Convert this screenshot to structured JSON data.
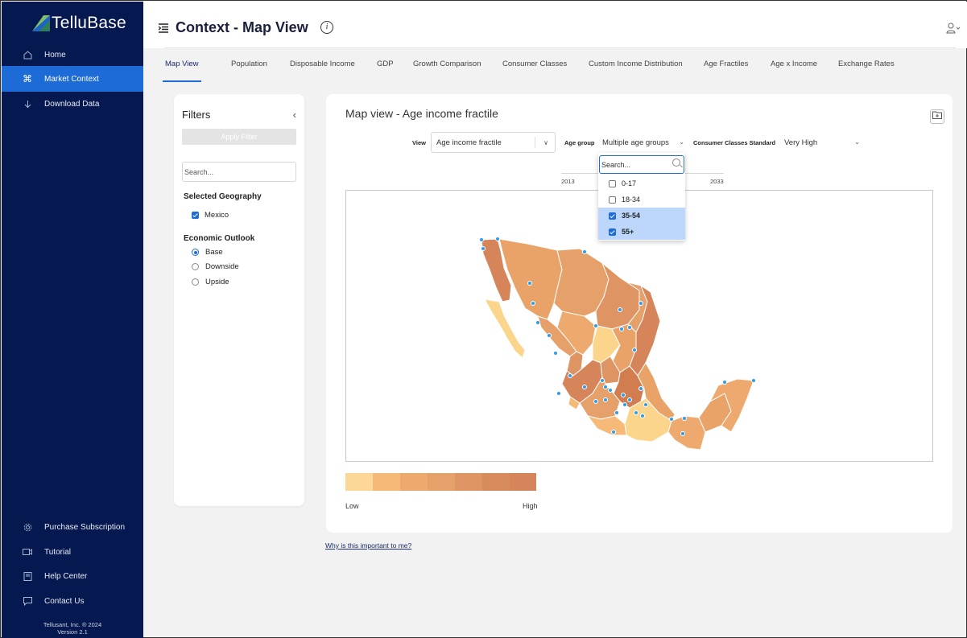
{
  "app": {
    "name": "TelluBase",
    "copyright_line1": "Tellusant, Inc. ® 2024",
    "copyright_line2": "Version 2.1"
  },
  "sidebar": {
    "items": [
      {
        "label": "Home",
        "icon": "home-icon"
      },
      {
        "label": "Market Context",
        "icon": "command-icon",
        "active": true
      },
      {
        "label": "Download Data",
        "icon": "download-icon"
      }
    ],
    "bottom_items": [
      {
        "label": "Purchase Subscription",
        "icon": "gear-icon"
      },
      {
        "label": "Tutorial",
        "icon": "video-icon"
      },
      {
        "label": "Help Center",
        "icon": "book-icon"
      },
      {
        "label": "Contact Us",
        "icon": "chat-icon"
      }
    ]
  },
  "header": {
    "title": "Context - Map View",
    "info_glyph": "i",
    "user_glyph": "user-icon"
  },
  "tabs": [
    {
      "label": "Map View",
      "active": true
    },
    {
      "label": "Population"
    },
    {
      "label": "Disposable Income"
    },
    {
      "label": "GDP"
    },
    {
      "label": "Growth Comparison"
    },
    {
      "label": "Consumer Classes"
    },
    {
      "label": "Custom Income Distribution"
    },
    {
      "label": "Age Fractiles"
    },
    {
      "label": "Age x Income"
    },
    {
      "label": "Exchange Rates"
    }
  ],
  "filters": {
    "title": "Filters",
    "apply_label": "Apply Filter",
    "search_placeholder": "Search...",
    "geography_label": "Selected Geography",
    "geography_value": "Mexico",
    "outlook_label": "Economic Outlook",
    "outlook_options": [
      "Base",
      "Downside",
      "Upside"
    ],
    "outlook_selected": "Base"
  },
  "main": {
    "title": "Map view - Age income fractile",
    "view_label": "View",
    "view_value": "Age income fractile",
    "age_group_label": "Age group",
    "age_group_value": "Multiple age groups",
    "standard_label": "Consumer Classes Standard",
    "standard_value": "Very High",
    "year_start": "2013",
    "year_end": "2033",
    "legend_low": "Low",
    "legend_high": "High",
    "legend_colors": [
      "#fcd796",
      "#f6b977",
      "#eeaa6e",
      "#e6a06a",
      "#df9463",
      "#d88c5e",
      "#d6845a"
    ],
    "why_link": "Why is this important to me?"
  },
  "dropdown": {
    "search_placeholder": "Search...",
    "options": [
      {
        "label": "0-17",
        "checked": false
      },
      {
        "label": "18-34",
        "checked": false
      },
      {
        "label": "35-54",
        "checked": true
      },
      {
        "label": "55+",
        "checked": true
      }
    ]
  },
  "colors": {
    "sidebar_bg": "#05184f",
    "accent": "#1c6bd6",
    "map_dark": "#d17d4f",
    "map_mid": "#e9a368",
    "map_light": "#fbd58c",
    "city_marker": "#2c9de8"
  }
}
